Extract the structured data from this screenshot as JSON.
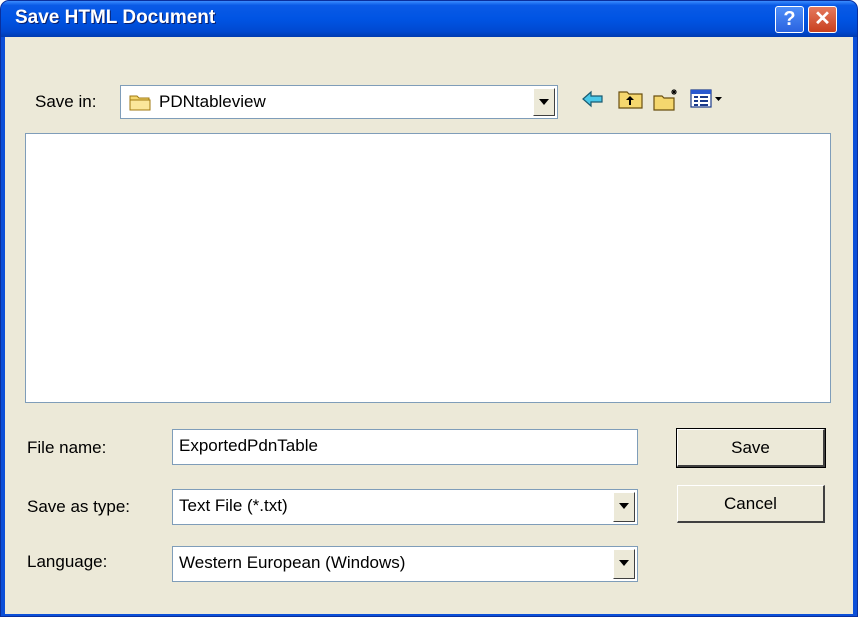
{
  "window": {
    "title": "Save HTML Document"
  },
  "toolbar": {
    "save_in_label": "Save in:",
    "save_in_value": "PDNtableview"
  },
  "form": {
    "file_name_label": "File name:",
    "file_name_value": "ExportedPdnTable",
    "save_as_type_label": "Save as type:",
    "save_as_type_value": "Text File (*.txt)",
    "language_label": "Language:",
    "language_value": "Western European (Windows)"
  },
  "buttons": {
    "save": "Save",
    "cancel": "Cancel",
    "help": "?",
    "close": "✕"
  },
  "colors": {
    "title_blue": "#0054e3",
    "dialog_bg": "#ece9d8",
    "close_red": "#c8401f"
  }
}
